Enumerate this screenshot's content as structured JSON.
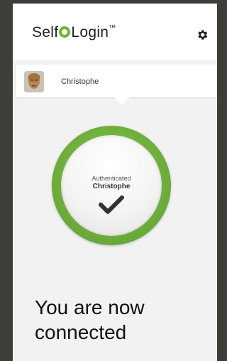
{
  "header": {
    "logo_text_before": "Self",
    "logo_text_after": "Login",
    "logo_trademark": "™",
    "settings_icon": "gear-icon"
  },
  "user": {
    "name": "Christophe",
    "avatar_icon": "user-avatar"
  },
  "status": {
    "label": "Authenticated",
    "name": "Christophe",
    "icon": "checkmark-icon",
    "ring_color": "#6eae3a"
  },
  "message": {
    "line1": "You are now",
    "line2": "connected"
  }
}
